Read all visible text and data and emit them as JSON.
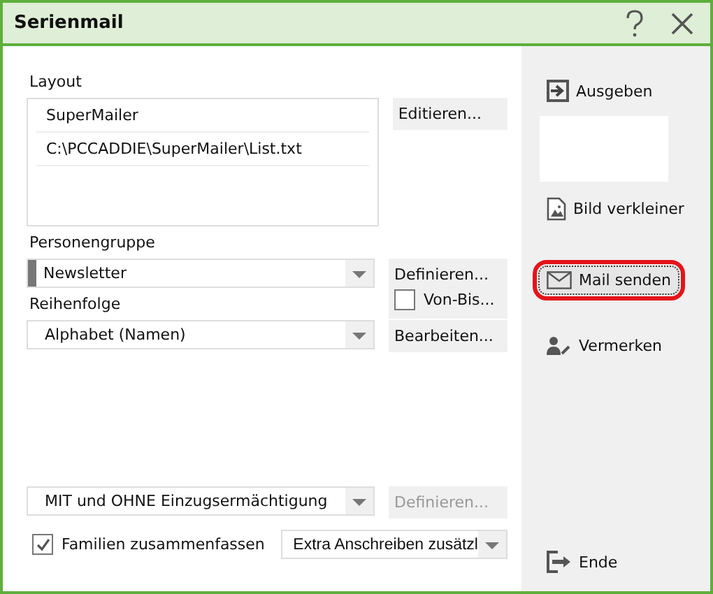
{
  "window": {
    "title": "Serienmail"
  },
  "layout": {
    "label": "Layout",
    "items": [
      "SuperMailer",
      "C:\\PCCADDIE\\SuperMailer\\List.txt"
    ],
    "button": {
      "label": "Editieren...",
      "disabled": false
    }
  },
  "personengruppe": {
    "label": "Personengruppe",
    "value": "Newsletter",
    "button": {
      "label": "Definieren...",
      "disabled": false
    },
    "range_checkbox": {
      "label": "Von-Bis...",
      "checked": false
    }
  },
  "reihenfolge": {
    "label": "Reihenfolge",
    "value": "Alphabet (Namen)",
    "button": {
      "label": "Bearbeiten...",
      "disabled": false
    }
  },
  "einzug": {
    "value": "MIT und OHNE Einzugsermächtigung",
    "button": {
      "label": "Definieren...",
      "disabled": true
    }
  },
  "familien": {
    "label": "Familien zusammenfassen",
    "checked": true
  },
  "anschreiben": {
    "value": "Extra Anschreiben zusätzl"
  },
  "actions": [
    {
      "kind": "output",
      "label": "Ausgeben",
      "highlighted": false
    },
    {
      "kind": "image",
      "label": "Bild verkleiner",
      "highlighted": false
    },
    {
      "kind": "mail",
      "label": "Mail senden",
      "highlighted": true
    },
    {
      "kind": "note",
      "label": "Vermerken",
      "highlighted": false
    },
    {
      "kind": "exit",
      "label": "Ende",
      "highlighted": false
    }
  ]
}
